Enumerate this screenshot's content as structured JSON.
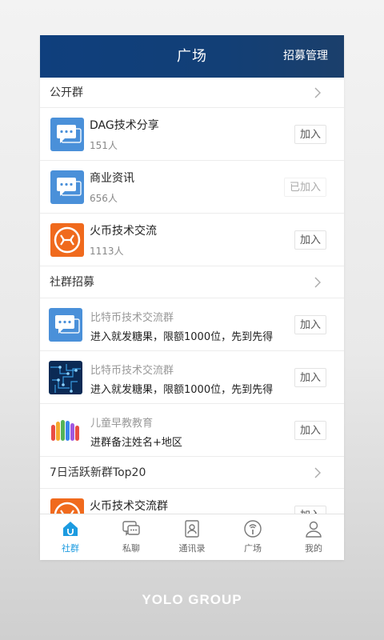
{
  "header": {
    "title": "广场",
    "action": "招募管理"
  },
  "sections": {
    "public": {
      "title": "公开群"
    },
    "recruit": {
      "title": "社群招募"
    },
    "active": {
      "title": "7日活跃新群Top20"
    }
  },
  "public_groups": [
    {
      "name": "DAG技术分享",
      "count": "151人",
      "button": "加入",
      "icon": "chat-bubble-icon"
    },
    {
      "name": "商业资讯",
      "count": "656人",
      "button": "已加入",
      "icon": "chat-bubble-icon"
    },
    {
      "name": "火币技术交流",
      "count": "1113人",
      "button": "加入",
      "icon": "huobi-logo-icon"
    }
  ],
  "recruit_items": [
    {
      "name": "比特币技术交流群",
      "desc": "进入就发糖果，限额1000位，先到先得",
      "button": "加入",
      "icon": "chat-bubble-icon"
    },
    {
      "name": "比特币技术交流群",
      "desc": "进入就发糖果，限额1000位，先到先得",
      "button": "加入",
      "icon": "circuit-image-icon"
    },
    {
      "name": "儿童早教教育",
      "desc": "进群备注姓名+地区",
      "button": "加入",
      "icon": "painted-hands-icon"
    }
  ],
  "active_groups": [
    {
      "name": "火币技术交流群",
      "button": "加入",
      "icon": "huobi-logo-icon"
    }
  ],
  "tabs": [
    {
      "label": "社群",
      "icon": "community-home-icon",
      "active": true
    },
    {
      "label": "私聊",
      "icon": "chat-icon",
      "active": false
    },
    {
      "label": "通讯录",
      "icon": "contacts-icon",
      "active": false
    },
    {
      "label": "广场",
      "icon": "plaza-icon",
      "active": false
    },
    {
      "label": "我的",
      "icon": "profile-icon",
      "active": false
    }
  ],
  "footer": {
    "brand": "YOLO GROUP"
  },
  "colors": {
    "header": "#0f3f7d",
    "accent": "#1c9be0",
    "chat_blue": "#4a90d9",
    "huobi_orange": "#f06a1d"
  }
}
